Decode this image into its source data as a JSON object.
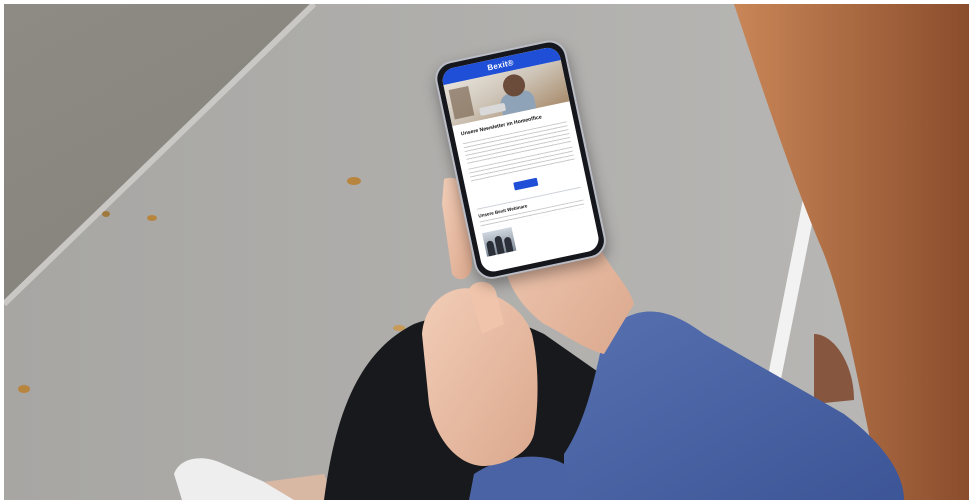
{
  "image": {
    "alt": ""
  },
  "phone_email": {
    "brand": "Bexit®",
    "headline": "Unsere Newsletter im Homeoffice",
    "body_lines": [],
    "button_label": "",
    "section_title": "Unsere Bexit Webinare"
  },
  "colors": {
    "brand_blue": "#1e4fd6",
    "sweater": "#45609e",
    "pavement": "#9a9894",
    "hair": "#b56e45"
  }
}
